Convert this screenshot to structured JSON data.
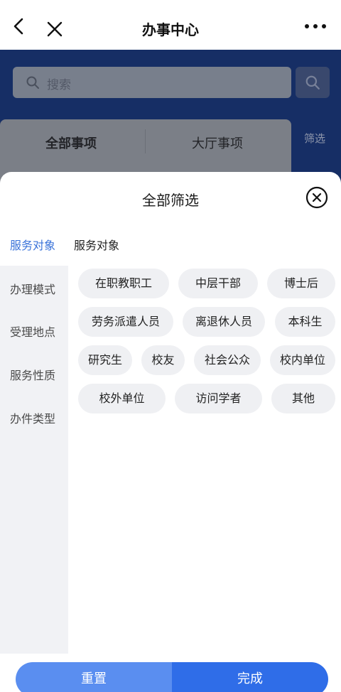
{
  "nav": {
    "title": "办事中心",
    "back_icon": "chevron-left-icon",
    "close_icon": "close-icon",
    "more_icon": "more-horizontal-icon"
  },
  "background_page": {
    "search_placeholder": "搜索",
    "tabs": [
      "全部事项",
      "大厅事项"
    ],
    "filter_label": "筛选"
  },
  "sheet": {
    "title": "全部筛选",
    "close_icon": "close-circle-icon",
    "active_category": "服务对象",
    "section_heading": "服务对象",
    "categories": [
      "办理模式",
      "受理地点",
      "服务性质",
      "办件类型"
    ],
    "options": [
      "在职教职工",
      "中层干部",
      "博士后",
      "劳务派遣人员",
      "离退休人员",
      "本科生",
      "研究生",
      "校友",
      "社会公众",
      "校内单位",
      "校外单位",
      "访问学者",
      "其他"
    ]
  },
  "actions": {
    "reset_label": "重置",
    "done_label": "完成"
  },
  "colors": {
    "accent": "#3a73d9",
    "primary_button": "#2f6de8",
    "secondary_button": "#5a8ef0",
    "chip_bg": "#eff0f3",
    "sidebar_bg": "#f1f2f5",
    "background_page": "#1d3c82"
  }
}
